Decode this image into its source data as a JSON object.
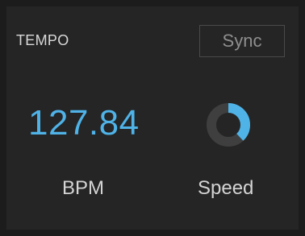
{
  "tempo": {
    "title": "TEMPO",
    "sync_label": "Sync",
    "bpm_value": "127.84",
    "bpm_label": "BPM",
    "speed_label": "Speed",
    "speed_level": 0.38
  },
  "colors": {
    "accent": "#4fb3e8",
    "knob_track": "#3f3f3f",
    "panel": "#252525",
    "background": "#1c1c1c"
  }
}
